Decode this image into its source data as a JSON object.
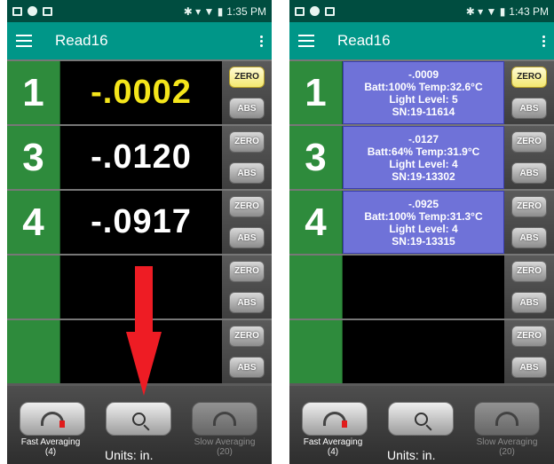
{
  "left": {
    "status": {
      "time": "1:35 PM",
      "icons": "✱ ▾ ▼ ▮"
    },
    "appbar": {
      "title": "Read16"
    },
    "rows": [
      {
        "num": "1",
        "value": "-.0002",
        "zero": "ZERO",
        "abs": "ABS"
      },
      {
        "num": "3",
        "value": "-.0120",
        "zero": "ZERO",
        "abs": "ABS"
      },
      {
        "num": "4",
        "value": "-.0917",
        "zero": "ZERO",
        "abs": "ABS"
      },
      {
        "num": "",
        "value": "",
        "zero": "ZERO",
        "abs": "ABS"
      },
      {
        "num": "",
        "value": "",
        "zero": "ZERO",
        "abs": "ABS"
      }
    ],
    "bottom": {
      "fast_label": "Fast Averaging",
      "fast_count": "(4)",
      "slow_label": "Slow Averaging",
      "slow_count": "(20)",
      "units": "Units: in."
    }
  },
  "right": {
    "status": {
      "time": "1:43 PM",
      "icons": "✱ ▾ ▼ ▮"
    },
    "appbar": {
      "title": "Read16"
    },
    "rows": [
      {
        "num": "1",
        "value": "-.0009",
        "line2": "Batt:100% Temp:32.6°C",
        "line3": "Light Level: 5",
        "line4": "SN:19-11614",
        "zero": "ZERO",
        "abs": "ABS"
      },
      {
        "num": "3",
        "value": "-.0127",
        "line2": "Batt:64% Temp:31.9°C",
        "line3": "Light Level: 4",
        "line4": "SN:19-13302",
        "zero": "ZERO",
        "abs": "ABS"
      },
      {
        "num": "4",
        "value": "-.0925",
        "line2": "Batt:100% Temp:31.3°C",
        "line3": "Light Level: 4",
        "line4": "SN:19-13315",
        "zero": "ZERO",
        "abs": "ABS"
      },
      {
        "num": "",
        "value": "",
        "zero": "ZERO",
        "abs": "ABS"
      },
      {
        "num": "",
        "value": "",
        "zero": "ZERO",
        "abs": "ABS"
      }
    ],
    "bottom": {
      "fast_label": "Fast Averaging",
      "fast_count": "(4)",
      "slow_label": "Slow Averaging",
      "slow_count": "(20)",
      "units": "Units: in."
    }
  },
  "colors": {
    "accent": "#009688",
    "status": "#004d40",
    "row_num": "#2e8b3c",
    "active_value": "#f5e61b",
    "info_panel": "#6f72d8",
    "arrow": "#ee1c24"
  }
}
